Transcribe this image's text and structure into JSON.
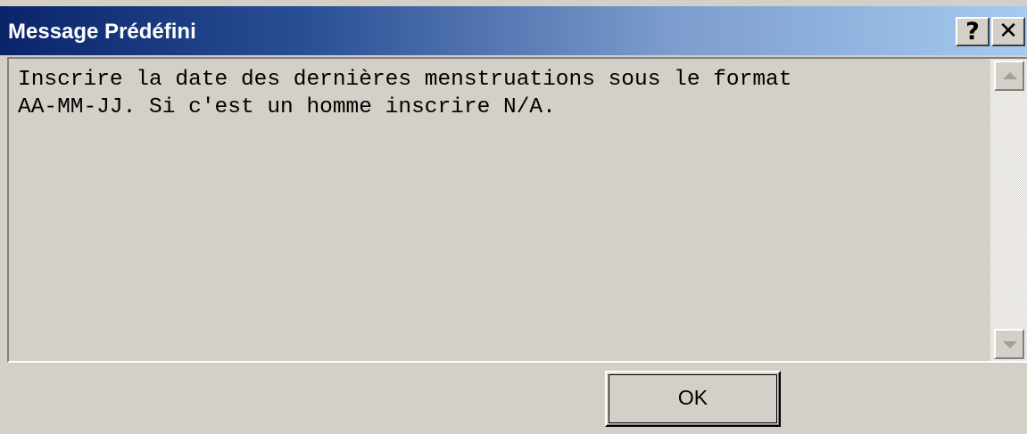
{
  "window": {
    "title": "Message Prédéfini",
    "help_label": "?",
    "close_label": "✕"
  },
  "message": {
    "text": "Inscrire la date des dernières menstruations sous le format\nAA-MM-JJ. Si c'est un homme inscrire N/A."
  },
  "scrollbar": {
    "up_icon": "arrow-up-icon",
    "down_icon": "arrow-down-icon"
  },
  "buttons": {
    "ok_label": "OK"
  },
  "colors": {
    "title_gradient_start": "#0a246a",
    "title_gradient_end": "#a6caf0",
    "face": "#d4d0c8"
  }
}
